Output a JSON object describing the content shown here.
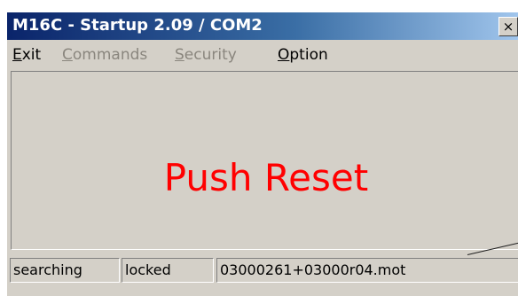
{
  "window": {
    "title": "M16C - Startup 2.09 / COM2",
    "close_glyph": "×"
  },
  "menu": {
    "items": [
      {
        "mnemonic": "E",
        "rest": "xit",
        "enabled": true
      },
      {
        "mnemonic": "C",
        "rest": "ommands",
        "enabled": false
      },
      {
        "mnemonic": "S",
        "rest": "ecurity",
        "enabled": false
      },
      {
        "mnemonic": "O",
        "rest": "ption",
        "enabled": true
      }
    ]
  },
  "main": {
    "message": "Push Reset",
    "message_color": "#ff0000"
  },
  "status": {
    "state": "searching",
    "lock": "locked",
    "file": "03000261+03000r04.mot"
  },
  "colors": {
    "title_gradient_start": "#0a246a",
    "title_gradient_end": "#a6caf0",
    "face": "#d4d0c8"
  }
}
